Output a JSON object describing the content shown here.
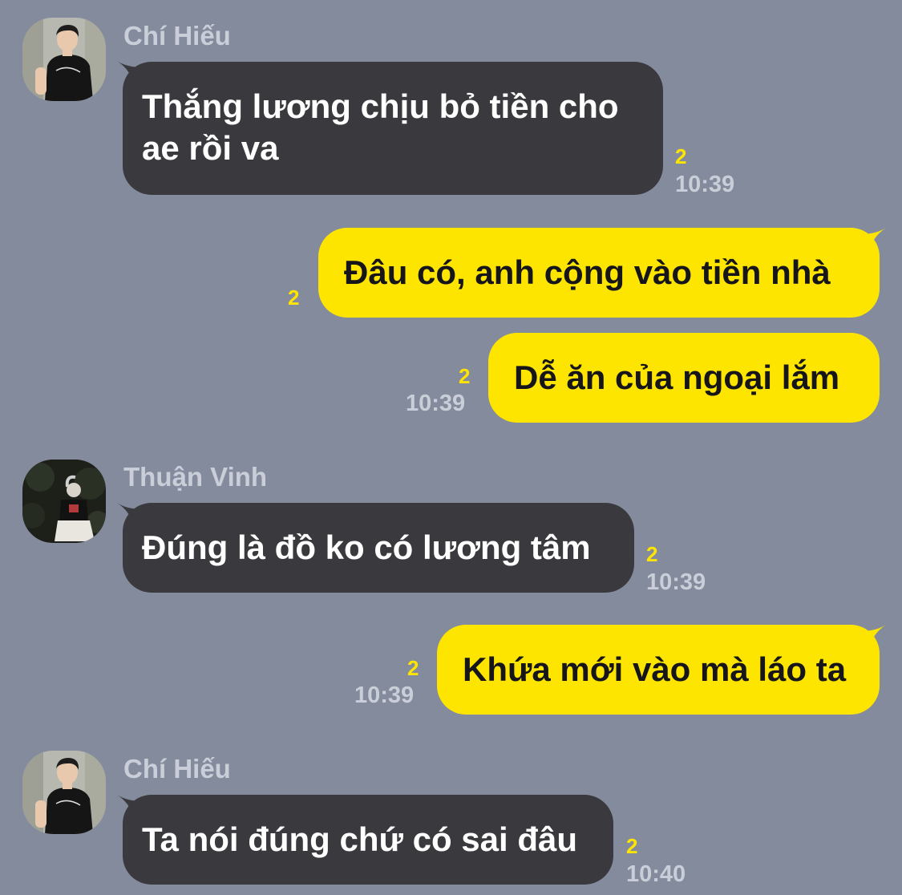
{
  "chat": {
    "background_color": "#848b9c",
    "incoming_bubble_color": "#3a3a3e",
    "outgoing_bubble_color": "#fee500",
    "unread_color": "#fee500",
    "messages": [
      {
        "direction": "incoming",
        "sender": "Chí Hiếu",
        "avatar": "avatar-chi-hieu",
        "lines": [
          "Thắng lương chịu bỏ tiền cho",
          "ae rồi va"
        ],
        "unread": "2",
        "time": "10:39"
      },
      {
        "direction": "outgoing",
        "text": "Đâu có, anh cộng vào tiền nhà",
        "unread": "2"
      },
      {
        "direction": "outgoing",
        "text": "Dễ ăn của ngoại lắm",
        "unread": "2",
        "time": "10:39"
      },
      {
        "direction": "incoming",
        "sender": "Thuận Vinh",
        "avatar": "avatar-thuan-vinh",
        "text": "Đúng là đồ ko có lương tâm",
        "unread": "2",
        "time": "10:39"
      },
      {
        "direction": "outgoing",
        "text": "Khứa mới vào mà láo ta",
        "unread": "2",
        "time": "10:39"
      },
      {
        "direction": "incoming",
        "sender": "Chí Hiếu",
        "avatar": "avatar-chi-hieu",
        "text": "Ta nói đúng chứ có sai đâu",
        "unread": "2",
        "time": "10:40"
      }
    ]
  }
}
